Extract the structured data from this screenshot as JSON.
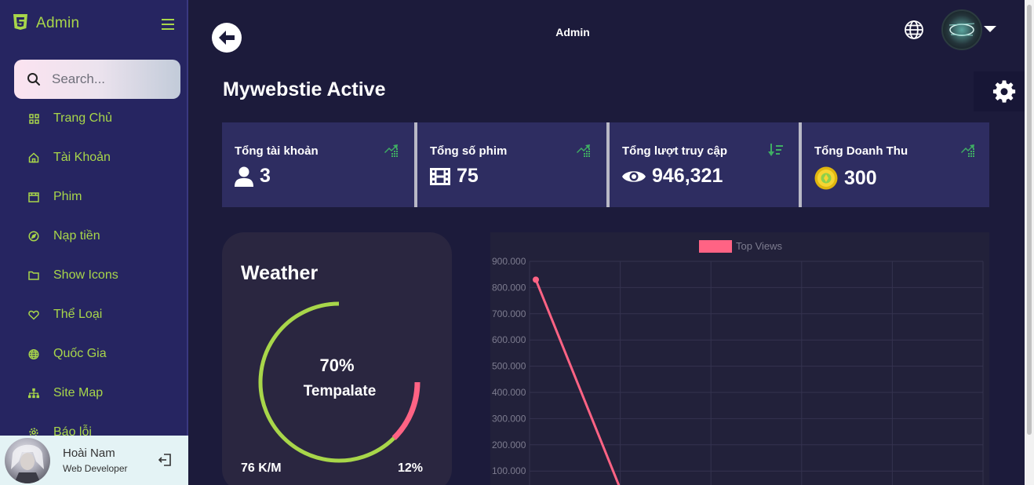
{
  "sidebar": {
    "brand": "Admin",
    "search_placeholder": "Search...",
    "items": [
      {
        "label": "Trang Chủ",
        "icon": "grid-icon"
      },
      {
        "label": "Tài Khoản",
        "icon": "home-icon"
      },
      {
        "label": "Phim",
        "icon": "film-icon"
      },
      {
        "label": "Nạp tiền",
        "icon": "compass-icon"
      },
      {
        "label": "Show Icons",
        "icon": "folder-icon"
      },
      {
        "label": "Thể Loại",
        "icon": "heart-icon"
      },
      {
        "label": "Quốc Gia",
        "icon": "globe-icon"
      },
      {
        "label": "Site Map",
        "icon": "sitemap-icon"
      },
      {
        "label": "Báo lỗi",
        "icon": "gear-icon"
      }
    ],
    "profile": {
      "name": "Hoài Nam",
      "role": "Web Developer"
    }
  },
  "header": {
    "title": "Admin"
  },
  "page_title": "Mywebstie Active",
  "stats": [
    {
      "label": "Tổng tài khoản",
      "value": "3",
      "icon": "user-icon",
      "trend": "trend-up-icon"
    },
    {
      "label": "Tổng số phim",
      "value": "75",
      "icon": "film-icon",
      "trend": "trend-up-icon"
    },
    {
      "label": "Tổng lượt truy cập",
      "value": "946,321",
      "icon": "eye-icon",
      "trend": "sort-down-icon"
    },
    {
      "label": "Tổng Doanh Thu",
      "value": "300",
      "icon": "coin-icon",
      "trend": "trend-up-icon"
    }
  ],
  "weather": {
    "title": "Weather",
    "percent": "70%",
    "label": "Tempalate",
    "fill": 0.7,
    "left_value": "76 K/M",
    "right_value": "12%"
  },
  "colors": {
    "accent": "#a8d64a",
    "line": "#ff6384",
    "card": "#2e2d61",
    "bg": "#1c1b3b"
  },
  "chart_data": {
    "type": "line",
    "series": [
      {
        "name": "Top Views",
        "x": [
          0,
          1
        ],
        "values": [
          830000,
          0
        ]
      }
    ],
    "yticks": [
      "900.000",
      "800.000",
      "700.000",
      "600.000",
      "500.000",
      "400.000",
      "300.000",
      "200.000",
      "100.000"
    ],
    "ylim": [
      0,
      900000
    ],
    "grid": true,
    "legend": "top"
  }
}
